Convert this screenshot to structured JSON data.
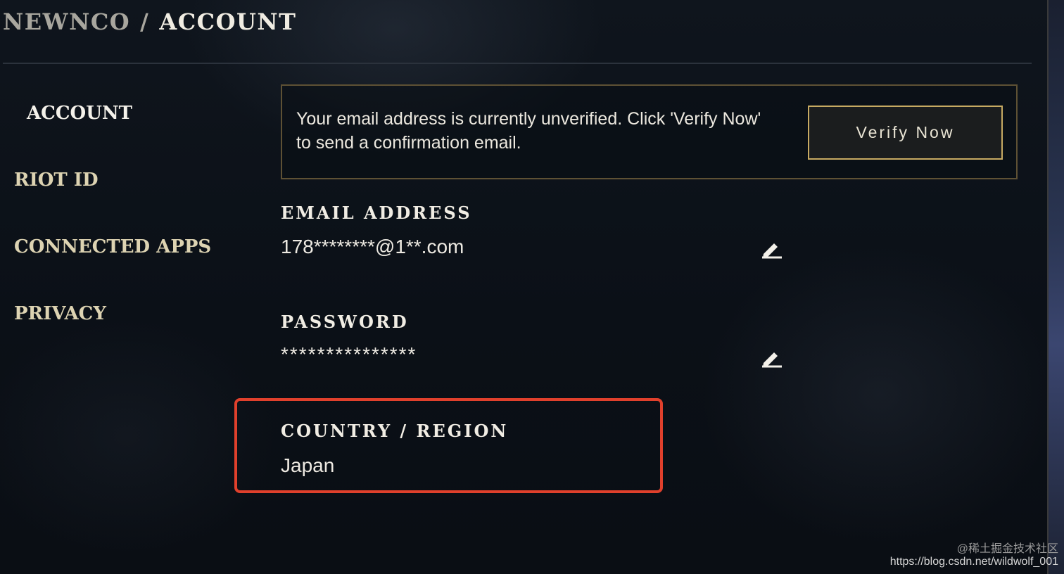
{
  "breadcrumb": {
    "parent": "NEWNCO",
    "separator": "/",
    "current": "ACCOUNT"
  },
  "sidebar": {
    "items": [
      {
        "label": "ACCOUNT",
        "active": true
      },
      {
        "label": "RIOT ID",
        "active": false
      },
      {
        "label": "CONNECTED APPS",
        "active": false
      },
      {
        "label": "PRIVACY",
        "active": false
      }
    ]
  },
  "verify_banner": {
    "message": "Your email address is currently unverified. Click 'Verify Now' to send a confirmation email.",
    "button_label": "Verify Now"
  },
  "fields": {
    "email": {
      "label": "EMAIL ADDRESS",
      "value": "178********@1**.com",
      "edit_icon": "pencil-edit-icon"
    },
    "password": {
      "label": "PASSWORD",
      "value": "***************",
      "edit_icon": "pencil-edit-icon"
    },
    "country": {
      "label": "COUNTRY / REGION",
      "value": "Japan"
    }
  },
  "watermark": {
    "line1": "@稀土掘金技术社区",
    "line2": "https://blog.csdn.net/wildwolf_001"
  },
  "colors": {
    "background": "#0c1118",
    "gold_border": "#c7aa62",
    "banner_border": "#5e5134",
    "sidebar_text": "#ddd3b2",
    "highlight_annotation": "#e0402c"
  }
}
